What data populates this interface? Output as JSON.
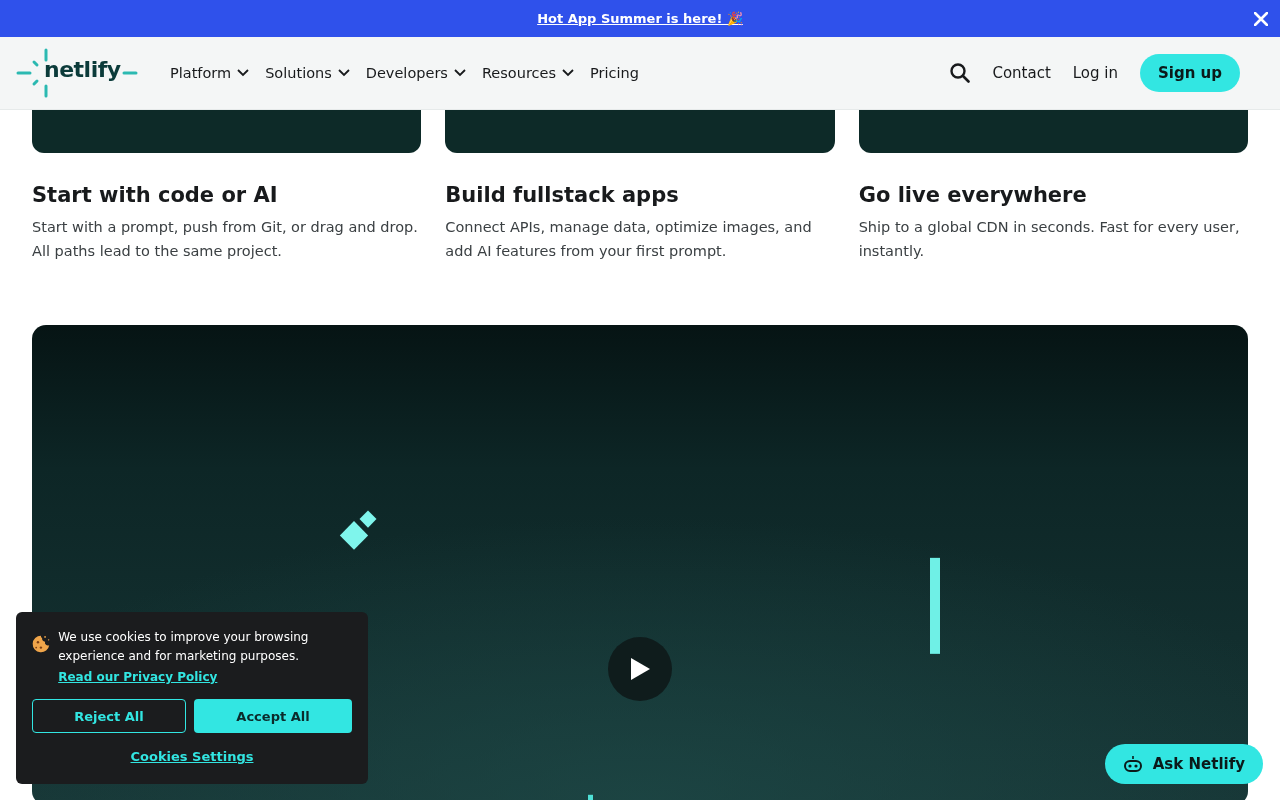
{
  "banner": {
    "link": "Hot App Summer is here! 🎉"
  },
  "header": {
    "logo": "netlify",
    "nav": [
      {
        "label": "Platform",
        "dropdown": true
      },
      {
        "label": "Solutions",
        "dropdown": true
      },
      {
        "label": "Developers",
        "dropdown": true
      },
      {
        "label": "Resources",
        "dropdown": true
      },
      {
        "label": "Pricing",
        "dropdown": false
      }
    ],
    "contact": "Contact",
    "login": "Log in",
    "signup": "Sign up"
  },
  "features": [
    {
      "title": "Start with code or AI",
      "text": "Start with a prompt, push from Git, or drag and drop. All paths lead to the same project."
    },
    {
      "title": "Build fullstack apps",
      "text": "Connect APIs, manage data, optimize images, and add AI features from your first prompt."
    },
    {
      "title": "Go live everywhere",
      "text": "Ship to a global CDN in seconds. Fast for every user, instantly."
    }
  ],
  "cookie_banner": {
    "text": "We use cookies to improve your browsing experience and for marketing purposes.",
    "policy_link": "Read our Privacy Policy",
    "reject": "Reject All",
    "accept": "Accept All",
    "settings": "Cookies Settings"
  },
  "chat_button": {
    "label": "Ask Netlify"
  }
}
